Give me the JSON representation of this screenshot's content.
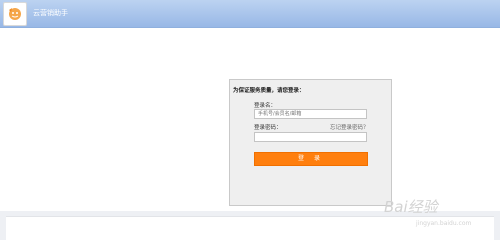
{
  "header": {
    "app_title": "云营销助手",
    "bg_color": "#a7c3ec"
  },
  "login": {
    "prompt": "为保证服务质量，请您登录：",
    "username_label": "登录名：",
    "username_placeholder": "手机号/会员名/邮箱",
    "password_label": "登录密码：",
    "forgot_link": "忘记登录密码？",
    "submit_label": "登 录",
    "accent_color": "#ff7f0e"
  },
  "watermark": {
    "text": "Bai经验",
    "sub": "jingyan.baidu.com"
  }
}
